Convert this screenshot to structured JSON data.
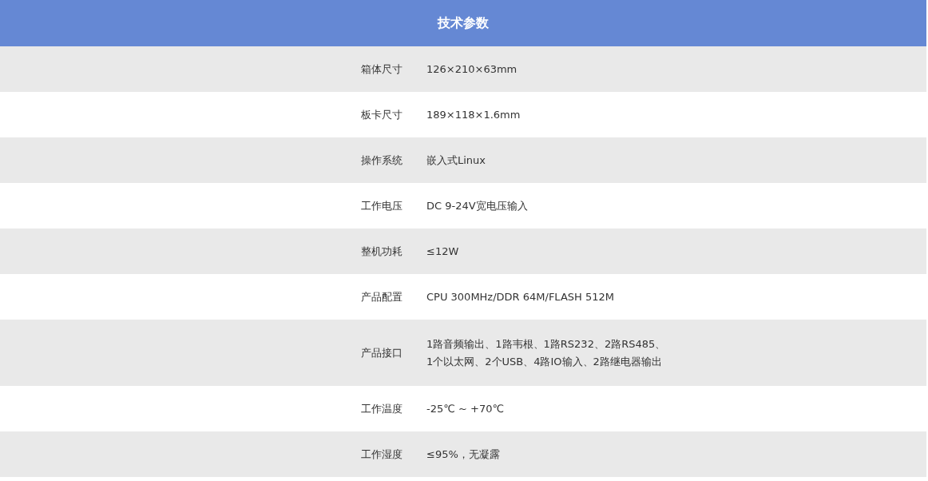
{
  "table": {
    "title": "技术参数",
    "rows": [
      {
        "label": "箱体尺寸",
        "value_lines": [
          "126×210×63mm"
        ]
      },
      {
        "label": "板卡尺寸",
        "value_lines": [
          "189×118×1.6mm"
        ]
      },
      {
        "label": "操作系统",
        "value_lines": [
          "嵌入式Linux"
        ]
      },
      {
        "label": "工作电压",
        "value_lines": [
          "DC 9-24V宽电压输入"
        ]
      },
      {
        "label": "整机功耗",
        "value_lines": [
          "≤12W"
        ]
      },
      {
        "label": "产品配置",
        "value_lines": [
          "CPU 300MHz/DDR 64M/FLASH 512M"
        ]
      },
      {
        "label": "产品接口",
        "value_lines": [
          "1路音频输出、1路韦根、1路RS232、2路RS485、",
          "1个以太网、2个USB、4路IO输入、2路继电器输出"
        ]
      },
      {
        "label": "工作温度",
        "value_lines": [
          "-25℃ ~ +70℃"
        ]
      },
      {
        "label": "工作湿度",
        "value_lines": [
          "≤95%，无凝露"
        ]
      }
    ]
  }
}
